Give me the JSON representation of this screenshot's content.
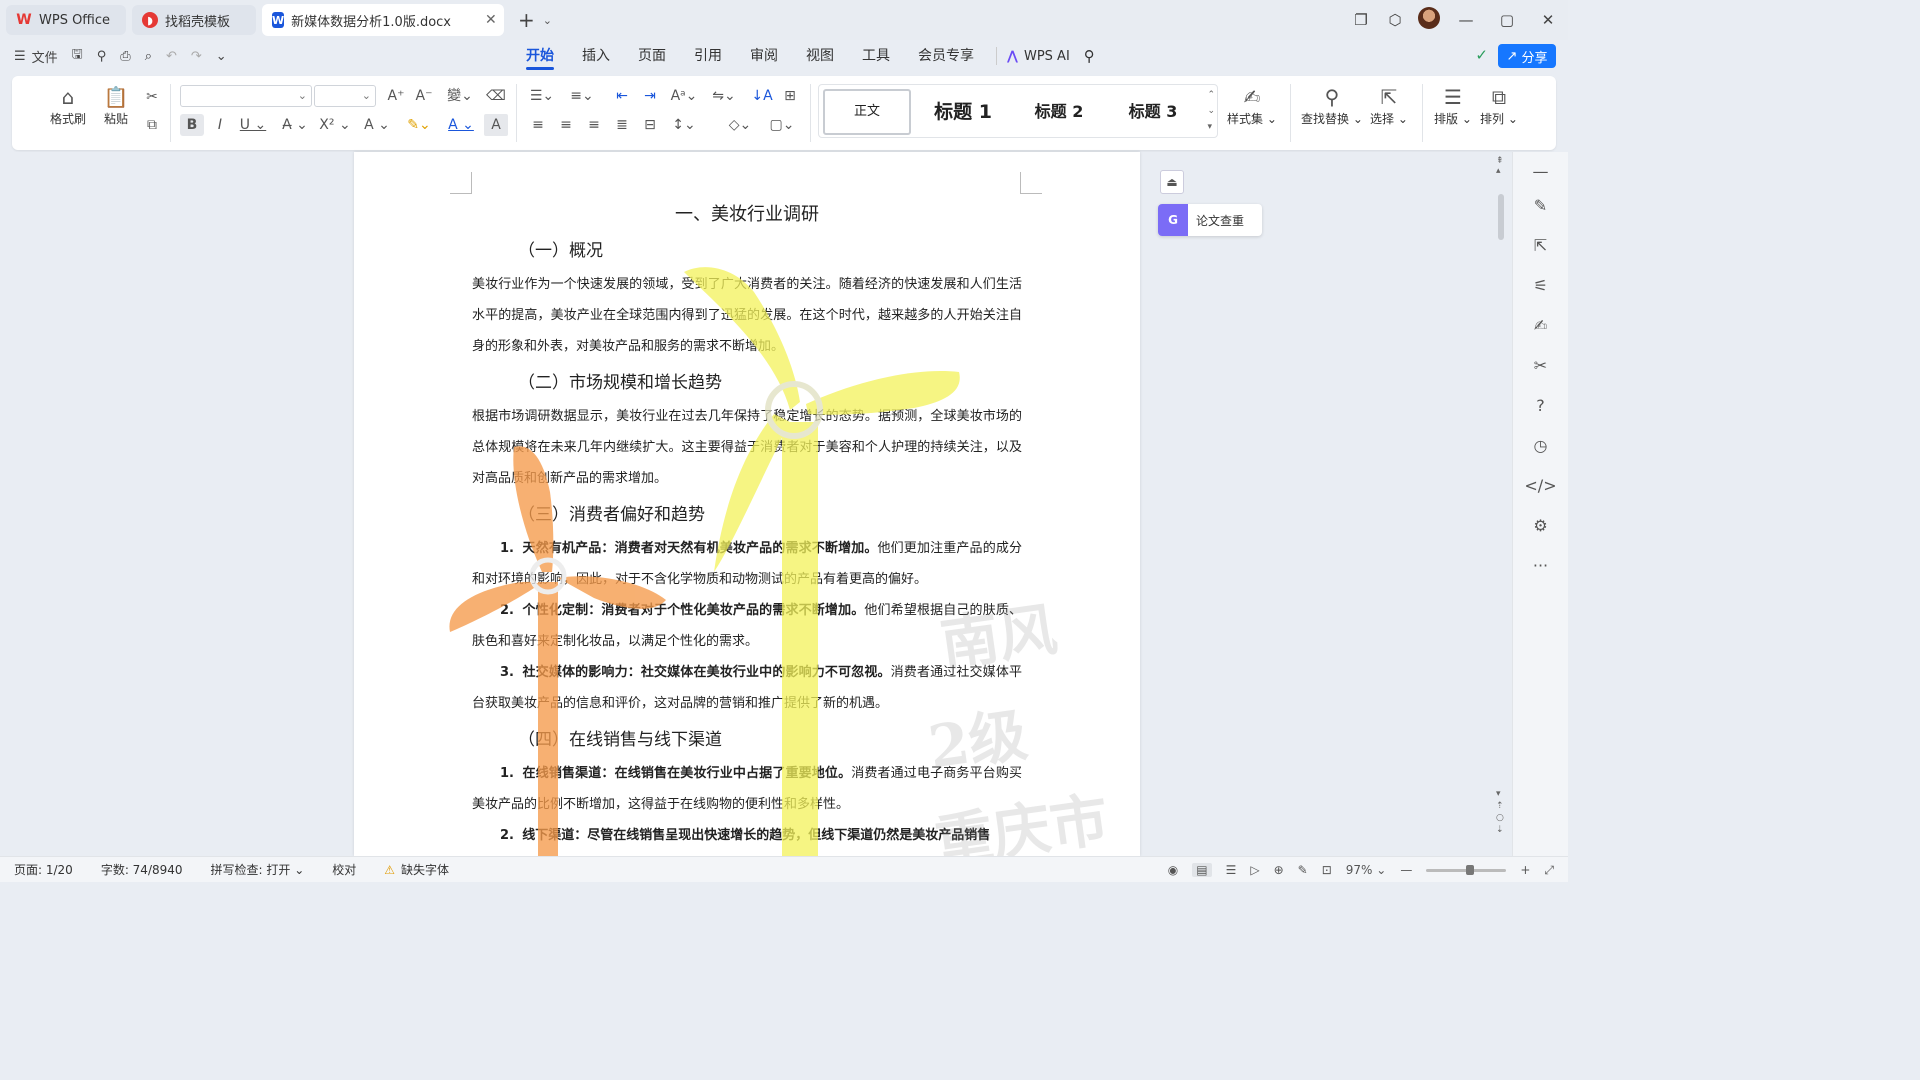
{
  "tabs": [
    {
      "label": "WPS Office",
      "icon": "wps-logo-icon",
      "color": "#e53935"
    },
    {
      "label": "找稻壳模板",
      "icon": "docer-icon",
      "color": "#e53935"
    },
    {
      "label": "新媒体数据分析1.0版.docx",
      "icon": "word-doc-icon",
      "color": "#1a56db"
    }
  ],
  "menu": {
    "file": "文件",
    "tabs": [
      "开始",
      "插入",
      "页面",
      "引用",
      "审阅",
      "视图",
      "工具",
      "会员专享"
    ],
    "active": "开始",
    "wps_ai": "WPS AI",
    "share": "分享"
  },
  "ribbon": {
    "format_painter": "格式刷",
    "paste": "粘贴",
    "styles": [
      "正文",
      "标题 1",
      "标题 2",
      "标题 3"
    ],
    "style_set": "样式集",
    "find_replace": "查找替换",
    "select": "选择",
    "layout": "排版",
    "arrange": "排列"
  },
  "side": {
    "paper_check": "论文查重"
  },
  "doc": {
    "title": "一、美妆行业调研",
    "s1": "（一）概况",
    "p1": "美妆行业作为一个快速发展的领域，受到了广大消费者的关注。随着经济的快速发展和人们生活水平的提高，美妆产业在全球范围内得到了迅猛的发展。在这个时代，越来越多的人开始关注自身的形象和外表，对美妆产品和服务的需求不断增加。",
    "s2": "（二）市场规模和增长趋势",
    "p2": "根据市场调研数据显示，美妆行业在过去几年保持了稳定增长的态势。据预测，全球美妆市场的总体规模将在未来几年内继续扩大。这主要得益于消费者对于美容和个人护理的持续关注，以及对高品质和创新产品的需求增加。",
    "s3": "（三）消费者偏好和趋势",
    "l1_num": "1.",
    "l1_bold": "天然有机产品：消费者对天然有机美妆产品的需求不断增加。",
    "l1_rest": "他们更加注重产品的成分和对环境的影响，因此，对于不含化学物质和动物测试的产品有着更高的偏好。",
    "l2_num": "2.",
    "l2_bold": "个性化定制：消费者对于个性化美妆产品的需求不断增加。",
    "l2_rest": "他们希望根据自己的肤质、肤色和喜好来定制化妆品，以满足个性化的需求。",
    "l3_num": "3.",
    "l3_bold": "社交媒体的影响力：社交媒体在美妆行业中的影响力不可忽视。",
    "l3_rest": "消费者通过社交媒体平台获取美妆产品的信息和评价，这对品牌的营销和推广提供了新的机遇。",
    "s4": "（四）在线销售与线下渠道",
    "l4_num": "1.",
    "l4_bold": "在线销售渠道：在线销售在美妆行业中占据了重要地位。",
    "l4_rest": "消费者通过电子商务平台购买美妆产品的比例不断增加，这得益于在线购物的便利性和多样性。",
    "l5_num": "2.",
    "l5_bold": "线下渠道：尽管在线销售呈现出快速增长的趋势，但线下渠道仍然是美妆产品销售"
  },
  "watermark": {
    "lines": [
      "南风",
      "2级",
      "重庆市"
    ]
  },
  "status": {
    "page": "页面: 1/20",
    "words": "字数: 74/8940",
    "spell": "拼写检查: 打开",
    "proof": "校对",
    "missing_font": "缺失字体",
    "zoom": "97%"
  },
  "colors": {
    "accent": "#1a56db",
    "share": "#1677ff",
    "windmill_yellow": "#f3f25a",
    "windmill_orange": "#f59a4a"
  }
}
